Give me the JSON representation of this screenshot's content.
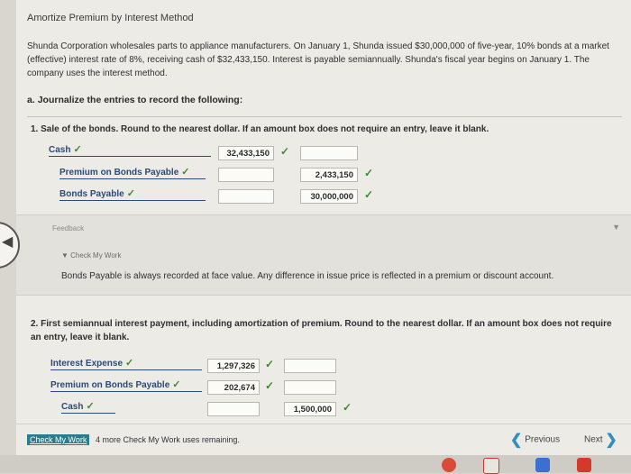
{
  "title": "Amortize Premium by Interest Method",
  "intro": "Shunda Corporation wholesales parts to appliance manufacturers. On January 1, Shunda issued $30,000,000 of five-year, 10% bonds at a market (effective) interest rate of 8%, receiving cash of $32,433,150. Interest is payable semiannually. Shunda's fiscal year begins on January 1. The company uses the interest method.",
  "part_a": {
    "label": "a.",
    "text": "Journalize the entries to record the following:"
  },
  "q1": {
    "number": "1.",
    "text": "Sale of the bonds. Round to the nearest dollar. If an amount box does not require an entry, leave it blank.",
    "rows": [
      {
        "account": "Cash",
        "debit": "32,433,150",
        "credit": ""
      },
      {
        "account": "Premium on Bonds Payable",
        "debit": "",
        "credit": "2,433,150"
      },
      {
        "account": "Bonds Payable",
        "debit": "",
        "credit": "30,000,000"
      }
    ]
  },
  "feedback": {
    "label": "Feedback",
    "check_my_work": "Check My Work",
    "text": "Bonds Payable is always recorded at face value. Any difference in issue price is reflected in a premium or discount account."
  },
  "q2": {
    "number": "2.",
    "text": "First semiannual interest payment, including amortization of premium. Round to the nearest dollar. If an amount box does not require an entry, leave it blank.",
    "rows": [
      {
        "account": "Interest Expense",
        "debit": "1,297,326",
        "credit": ""
      },
      {
        "account": "Premium on Bonds Payable",
        "debit": "202,674",
        "credit": ""
      },
      {
        "account": "Cash",
        "debit": "",
        "credit": "1,500,000"
      }
    ]
  },
  "footer": {
    "check_button": "Check My Work",
    "remaining": "4 more Check My Work uses remaining.",
    "previous": "Previous",
    "next": "Next"
  },
  "colors": {
    "check": "#3d8b2e",
    "link": "#2c4a7a",
    "button": "#2a7a90",
    "nav_arrow": "#2f8fc0"
  },
  "icons": [
    "checkmark-icon",
    "chevron-left-icon",
    "chevron-right-icon",
    "chevron-down-icon",
    "arrow-left-icon"
  ]
}
